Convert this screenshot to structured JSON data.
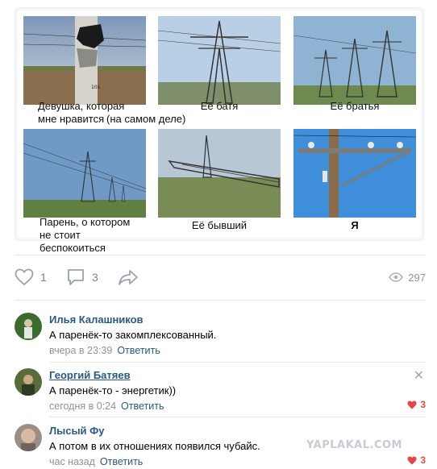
{
  "meme": {
    "captions": [
      "Девушка, которая мне нравится",
      "Её батя",
      "Её братья",
      "Парень, о котором не стоит беспокоиться",
      "Её бывший",
      "Я"
    ],
    "aside": "(на самом деле)",
    "pole_label": "101"
  },
  "reactions": {
    "likes": "1",
    "comments": "3",
    "views": "297"
  },
  "comments": [
    {
      "author": "Илья Калашников",
      "text": "А паренёк-то закомплексованный.",
      "time": "вчера в 23:39",
      "reply": "Ответить"
    },
    {
      "author": "Георгий Батяев",
      "text": "А паренёк-то - энергетик))",
      "time": "сегодня в 0:24",
      "reply": "Ответить",
      "likes": "3"
    },
    {
      "author": "Лысый Фу",
      "text": "А потом в их отношениях появился чубайс.",
      "time": "час назад",
      "reply": "Ответить",
      "likes": "3"
    }
  ],
  "watermark": "YAPLAKAL.COM",
  "colors": {
    "link": "#2a5885",
    "muted": "#939393",
    "like": "#e64646"
  }
}
